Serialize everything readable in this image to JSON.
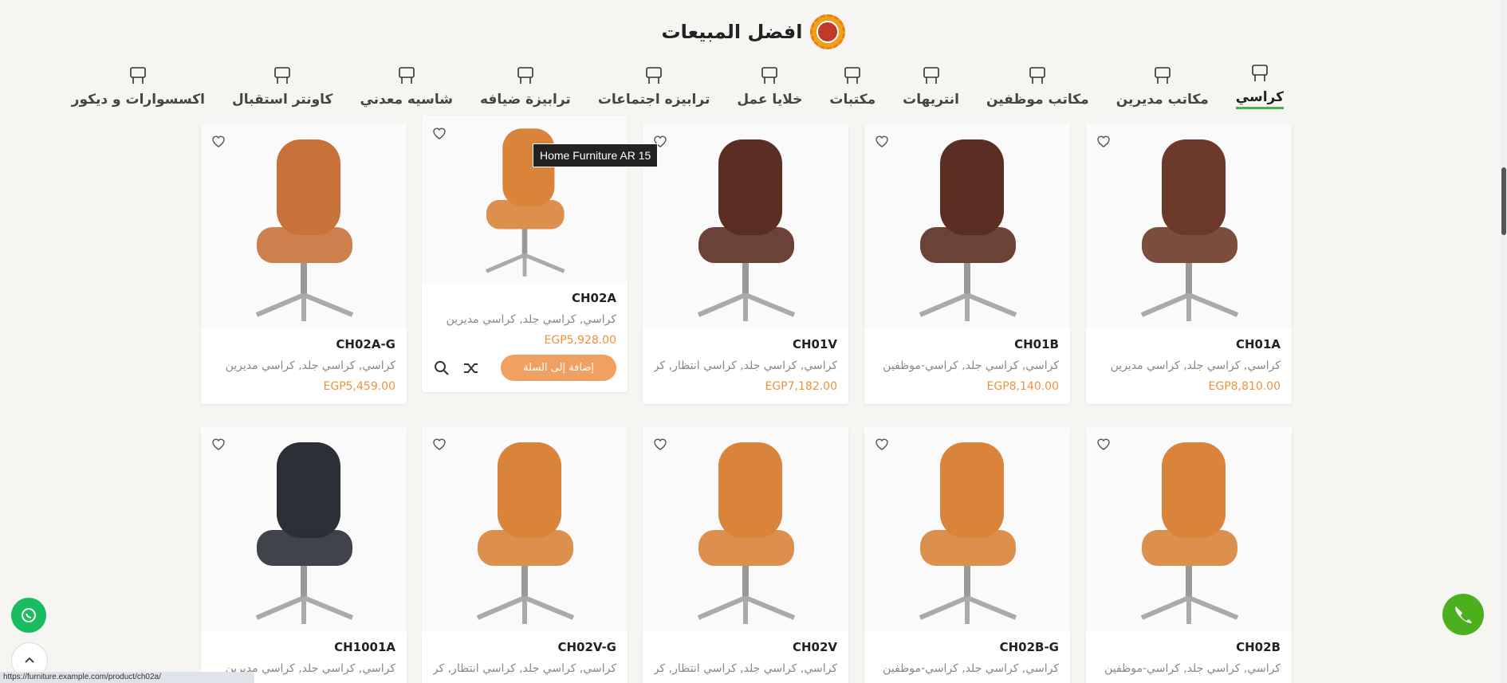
{
  "section": {
    "title": "افضل المبيعات"
  },
  "tabs": [
    {
      "label": "كراسي",
      "icon": "chair-icon",
      "active": true
    },
    {
      "label": "مكاتب مديرين",
      "icon": "desk-icon"
    },
    {
      "label": "مكاتب موظفين",
      "icon": "office-desk-icon"
    },
    {
      "label": "انتريهات",
      "icon": "sofa-icon"
    },
    {
      "label": "مكتبات",
      "icon": "cabinet-icon"
    },
    {
      "label": "خلايا عمل",
      "icon": "workstation-icon"
    },
    {
      "label": "ترابيزه اجتماعات",
      "icon": "meeting-table-icon"
    },
    {
      "label": "ترابيزة ضيافه",
      "icon": "coffee-table-icon"
    },
    {
      "label": "شاسيه معدني",
      "icon": "metal-cabinet-icon"
    },
    {
      "label": "كاونتر استقبال",
      "icon": "reception-counter-icon"
    },
    {
      "label": "اكسسوارات و ديكور",
      "icon": "decor-icon"
    }
  ],
  "tooltip": "Home Furniture AR 15",
  "products": [
    {
      "name": "CH01A",
      "cats": "كراسي, كراسي جلد, كراسي مديرين",
      "price": "EGP8,810.00",
      "color": "#6b3a2a"
    },
    {
      "name": "CH01B",
      "cats": "كراسي, كراسي جلد, كراسي-موظفين",
      "price": "EGP8,140.00",
      "color": "#5a2e22"
    },
    {
      "name": "CH01V",
      "cats": "كراسي, كراسي جلد, كراسي انتظار, كراسي",
      "price": "EGP7,182.00",
      "color": "#5a2e22"
    },
    {
      "name": "CH02A",
      "cats": "كراسي, كراسي جلد, كراسي مديرين",
      "price": "EGP5,928.00",
      "color": "#d9843a",
      "hover": true
    },
    {
      "name": "CH02A-G",
      "cats": "كراسي, كراسي جلد, كراسي مديرين",
      "price": "EGP5,459.00",
      "color": "#c8723a"
    },
    {
      "name": "CH02B",
      "cats": "كراسي, كراسي جلد, كراسي-موظفين",
      "price": "",
      "color": "#d9843a"
    },
    {
      "name": "CH02B-G",
      "cats": "كراسي, كراسي جلد, كراسي-موظفين",
      "price": "",
      "color": "#d9843a"
    },
    {
      "name": "CH02V",
      "cats": "كراسي, كراسي جلد, كراسي انتظار, كراسي",
      "price": "",
      "color": "#d9843a"
    },
    {
      "name": "CH02V-G",
      "cats": "كراسي, كراسي جلد, كراسي انتظار, كراسي",
      "price": "",
      "color": "#d9843a"
    },
    {
      "name": "CH1001A",
      "cats": "كراسي, كراسي جلد, كراسي مديرين",
      "price": "",
      "color": "#2b2f36"
    }
  ],
  "add_to_cart": "إضافة إلى السلة",
  "status_url": "https://furniture.example.com/product/ch02a/"
}
